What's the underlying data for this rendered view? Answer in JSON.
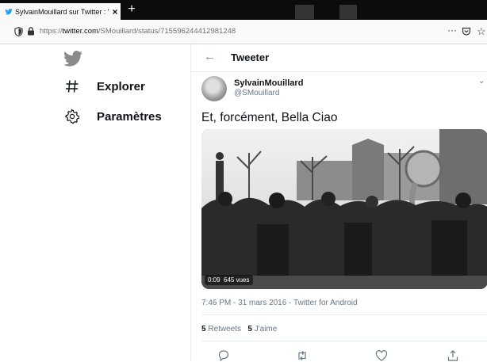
{
  "browser": {
    "tab_title": "SylvainMouillard sur Twitter : \"E",
    "tab_close": "×",
    "new_tab": "+",
    "url_prefix": "https://",
    "url_domain": "twitter.com",
    "url_path": "/SMouillard/status/715596244412981248",
    "more": "···",
    "star": "☆"
  },
  "sidebar": {
    "items": [
      {
        "label": "Explorer",
        "icon": "hashtag-icon"
      },
      {
        "label": "Paramètres",
        "icon": "settings-gear-icon"
      }
    ]
  },
  "header": {
    "back": "←",
    "title": "Tweeter"
  },
  "tweet": {
    "user_name": "SylvainMouillard",
    "handle": "@SMouillard",
    "caret": "⌄",
    "text": "Et, forcément, Bella Ciao",
    "video_time": "0:09",
    "video_views": "645 vues",
    "meta": "7:46 PM - 31 mars 2016 - Twitter for Android",
    "retweets_count": "5",
    "retweets_label": "Retweets",
    "likes_count": "5",
    "likes_label": "J'aime"
  },
  "colors": {
    "accent": "#1da1f2",
    "icon_gray": "#657786",
    "tabbar": "#0c0c0d"
  }
}
